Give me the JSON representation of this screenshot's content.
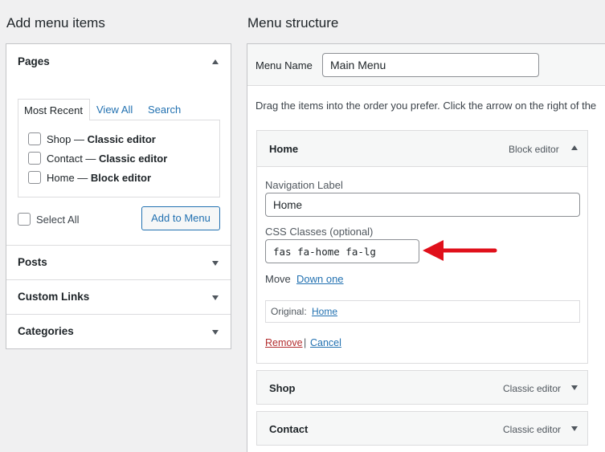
{
  "left": {
    "heading": "Add menu items",
    "pages": {
      "title": "Pages",
      "tabs": [
        "Most Recent",
        "View All",
        "Search"
      ],
      "items": [
        {
          "title": "Shop",
          "sep": " — ",
          "editor": "Classic editor"
        },
        {
          "title": "Contact",
          "sep": " — ",
          "editor": "Classic editor"
        },
        {
          "title": "Home",
          "sep": " — ",
          "editor": "Block editor"
        }
      ],
      "select_all": "Select All",
      "add_button": "Add to Menu"
    },
    "sections": [
      "Posts",
      "Custom Links",
      "Categories"
    ]
  },
  "right": {
    "heading": "Menu structure",
    "menu_name_label": "Menu Name",
    "menu_name_value": "Main Menu",
    "instructions": "Drag the items into the order you prefer. Click the arrow on the right of the",
    "home_item": {
      "title": "Home",
      "type": "Block editor",
      "nav_label_label": "Navigation Label",
      "nav_label_value": "Home",
      "css_label": "CSS Classes (optional)",
      "css_value": "fas fa-home fa-lg",
      "move_label": "Move",
      "move_link": "Down one",
      "original_label": "Original:",
      "original_link": "Home",
      "remove": "Remove",
      "divider": "|",
      "cancel": "Cancel"
    },
    "other_items": [
      {
        "title": "Shop",
        "type": "Classic editor"
      },
      {
        "title": "Contact",
        "type": "Classic editor"
      }
    ]
  },
  "colors": {
    "arrow": "#e0101b",
    "link": "#2271b1",
    "remove": "#b32d2e"
  }
}
